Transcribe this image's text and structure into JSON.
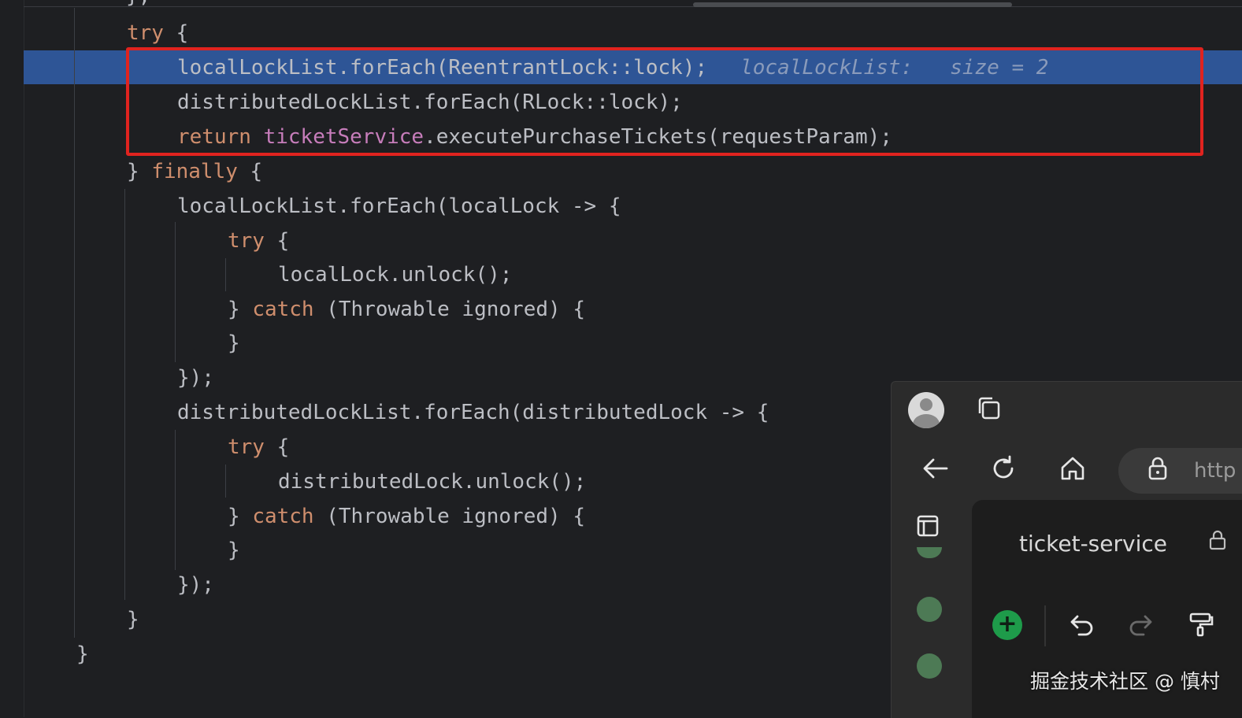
{
  "editor": {
    "prev_line_fragment": "},",
    "lines": [
      {
        "id": "l1",
        "kw": "try",
        "rest": " {"
      },
      {
        "id": "l2",
        "text": "localLockList.forEach(ReentrantLock::lock);",
        "hint": "localLockList:   size = 2"
      },
      {
        "id": "l3",
        "text": "distributedLockList.forEach(RLock::lock);"
      },
      {
        "id": "l4",
        "kw": "return",
        "field": "ticketService",
        "rest": ".executePurchaseTickets(requestParam);"
      },
      {
        "id": "l5",
        "pre": "} ",
        "kw": "finally",
        "rest": " {"
      },
      {
        "id": "l6",
        "text": "localLockList.forEach(localLock -> {"
      },
      {
        "id": "l7",
        "kw": "try",
        "rest": " {"
      },
      {
        "id": "l8",
        "text": "localLock.unlock();"
      },
      {
        "id": "l9",
        "pre": "} ",
        "kw": "catch",
        "rest": " (Throwable ignored) {"
      },
      {
        "id": "l10",
        "text": "}"
      },
      {
        "id": "l11",
        "text": "});"
      },
      {
        "id": "l12",
        "text": "distributedLockList.forEach(distributedLock -> {"
      },
      {
        "id": "l13",
        "kw": "try",
        "rest": " {"
      },
      {
        "id": "l14",
        "text": "distributedLock.unlock();"
      },
      {
        "id": "l15",
        "pre": "} ",
        "kw": "catch",
        "rest": " (Throwable ignored) {"
      },
      {
        "id": "l16",
        "text": "}"
      },
      {
        "id": "l17",
        "text": "});"
      },
      {
        "id": "l18",
        "text": "}"
      },
      {
        "id": "l19",
        "text": "}"
      }
    ],
    "colors": {
      "background": "#1e1f22",
      "highlight": "#2e5596",
      "keyword": "#cf8e6d",
      "field": "#c77dbb",
      "annotation_box": "#e0231f"
    }
  },
  "overlay": {
    "icons": [
      "avatar-icon",
      "tabs-icon",
      "back-arrow-icon",
      "refresh-icon",
      "home-icon",
      "lock-icon",
      "sidebar-panel-icon",
      "lock-small-icon",
      "add-icon",
      "undo-icon",
      "redo-icon",
      "paint-brush-icon"
    ],
    "url_text": "http",
    "panel_title": "ticket-service",
    "plus_label": "+"
  },
  "watermark": "掘金技术社区 @ 慎村"
}
